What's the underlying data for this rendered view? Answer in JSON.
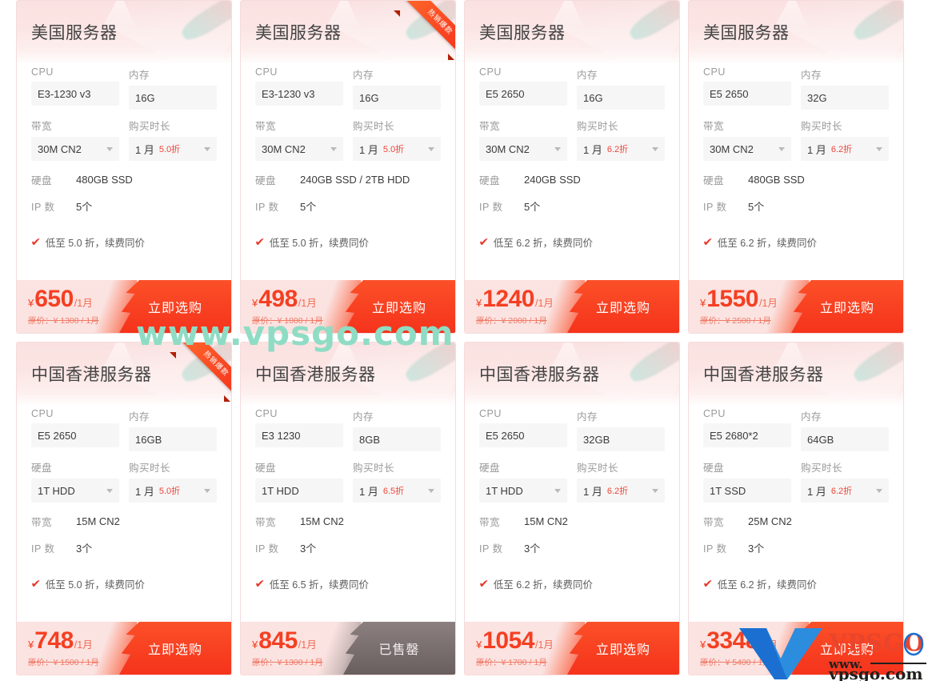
{
  "labels": {
    "cpu": "CPU",
    "memory": "内存",
    "bandwidth": "带宽",
    "duration": "购买时长",
    "disk": "硬盘",
    "ip": "IP 数",
    "ribbon": "热销爆款",
    "buy": "立即选购",
    "soldout": "已售罄",
    "orig_prefix": "原价：",
    "yen": "¥",
    "tick": "✔"
  },
  "watermark": {
    "center": "www.vpsgo.com",
    "logo_name": "VPSGO",
    "logo_url": "www.vpsgo.com",
    "color_center": "#8fdcc4",
    "color_logo": "#1b6fd0"
  },
  "colors": {
    "accent_red": "#f5331c",
    "price_red": "#f53f22",
    "discount_red": "#f0453a",
    "footer_bg": "#fbe3e1",
    "soldout_gray": "#6a5f5f"
  },
  "cards": [
    {
      "title": "美国服务器",
      "ribbon": false,
      "cpu": "E3-1230 v3",
      "memory": "16G",
      "select1_label": "带宽",
      "select1_value": "30M CN2",
      "duration": "1 月",
      "discount": "5.0折",
      "flat1_label": "硬盘",
      "flat1_value": "480GB SSD",
      "flat2_label": "IP 数",
      "flat2_value": "5个",
      "feature": "低至 5.0 折，续费同价",
      "price": "650",
      "per": "/1月",
      "orig": "原价：¥ 1300 / 1月",
      "sold_out": false
    },
    {
      "title": "美国服务器",
      "ribbon": true,
      "cpu": "E3-1230 v3",
      "memory": "16G",
      "select1_label": "带宽",
      "select1_value": "30M CN2",
      "duration": "1 月",
      "discount": "5.0折",
      "flat1_label": "硬盘",
      "flat1_value": "240GB SSD / 2TB HDD",
      "flat2_label": "IP 数",
      "flat2_value": "5个",
      "feature": "低至 5.0 折，续费同价",
      "price": "498",
      "per": "/1月",
      "orig": "原价：¥ 1000 / 1月",
      "sold_out": false
    },
    {
      "title": "美国服务器",
      "ribbon": false,
      "cpu": "E5 2650",
      "memory": "16G",
      "select1_label": "带宽",
      "select1_value": "30M CN2",
      "duration": "1 月",
      "discount": "6.2折",
      "flat1_label": "硬盘",
      "flat1_value": "240GB SSD",
      "flat2_label": "IP 数",
      "flat2_value": "5个",
      "feature": "低至 6.2 折，续费同价",
      "price": "1240",
      "per": "/1月",
      "orig": "原价：¥ 2000 / 1月",
      "sold_out": false
    },
    {
      "title": "美国服务器",
      "ribbon": false,
      "cpu": "E5 2650",
      "memory": "32G",
      "select1_label": "带宽",
      "select1_value": "30M CN2",
      "duration": "1 月",
      "discount": "6.2折",
      "flat1_label": "硬盘",
      "flat1_value": "480GB SSD",
      "flat2_label": "IP 数",
      "flat2_value": "5个",
      "feature": "低至 6.2 折，续费同价",
      "price": "1550",
      "per": "/1月",
      "orig": "原价：¥ 2500 / 1月",
      "sold_out": false
    },
    {
      "title": "中国香港服务器",
      "ribbon": true,
      "cpu": "E5 2650",
      "memory": "16GB",
      "select1_label": "硬盘",
      "select1_value": "1T HDD",
      "duration": "1 月",
      "discount": "5.0折",
      "flat1_label": "带宽",
      "flat1_value": "15M CN2",
      "flat2_label": "IP 数",
      "flat2_value": "3个",
      "feature": "低至 5.0 折，续费同价",
      "price": "748",
      "per": "/1月",
      "orig": "原价：¥ 1500 / 1月",
      "sold_out": false
    },
    {
      "title": "中国香港服务器",
      "ribbon": false,
      "cpu": "E3 1230",
      "memory": "8GB",
      "select1_label": "硬盘",
      "select1_value": "1T HDD",
      "duration": "1 月",
      "discount": "6.5折",
      "flat1_label": "带宽",
      "flat1_value": "15M CN2",
      "flat2_label": "IP 数",
      "flat2_value": "3个",
      "feature": "低至 6.5 折，续费同价",
      "price": "845",
      "per": "/1月",
      "orig": "原价：¥ 1300 / 1月",
      "sold_out": true
    },
    {
      "title": "中国香港服务器",
      "ribbon": false,
      "cpu": "E5 2650",
      "memory": "32GB",
      "select1_label": "硬盘",
      "select1_value": "1T HDD",
      "duration": "1 月",
      "discount": "6.2折",
      "flat1_label": "带宽",
      "flat1_value": "15M CN2",
      "flat2_label": "IP 数",
      "flat2_value": "3个",
      "feature": "低至 6.2 折，续费同价",
      "price": "1054",
      "per": "/1月",
      "orig": "原价：¥ 1700 / 1月",
      "sold_out": false
    },
    {
      "title": "中国香港服务器",
      "ribbon": false,
      "cpu": "E5 2680*2",
      "memory": "64GB",
      "select1_label": "硬盘",
      "select1_value": "1T SSD",
      "duration": "1 月",
      "discount": "6.2折",
      "flat1_label": "带宽",
      "flat1_value": "25M CN2",
      "flat2_label": "IP 数",
      "flat2_value": "3个",
      "feature": "低至 6.2 折，续费同价",
      "price": "3348",
      "per": "/1月",
      "orig": "原价：¥ 5400 / 1月",
      "sold_out": false
    }
  ]
}
